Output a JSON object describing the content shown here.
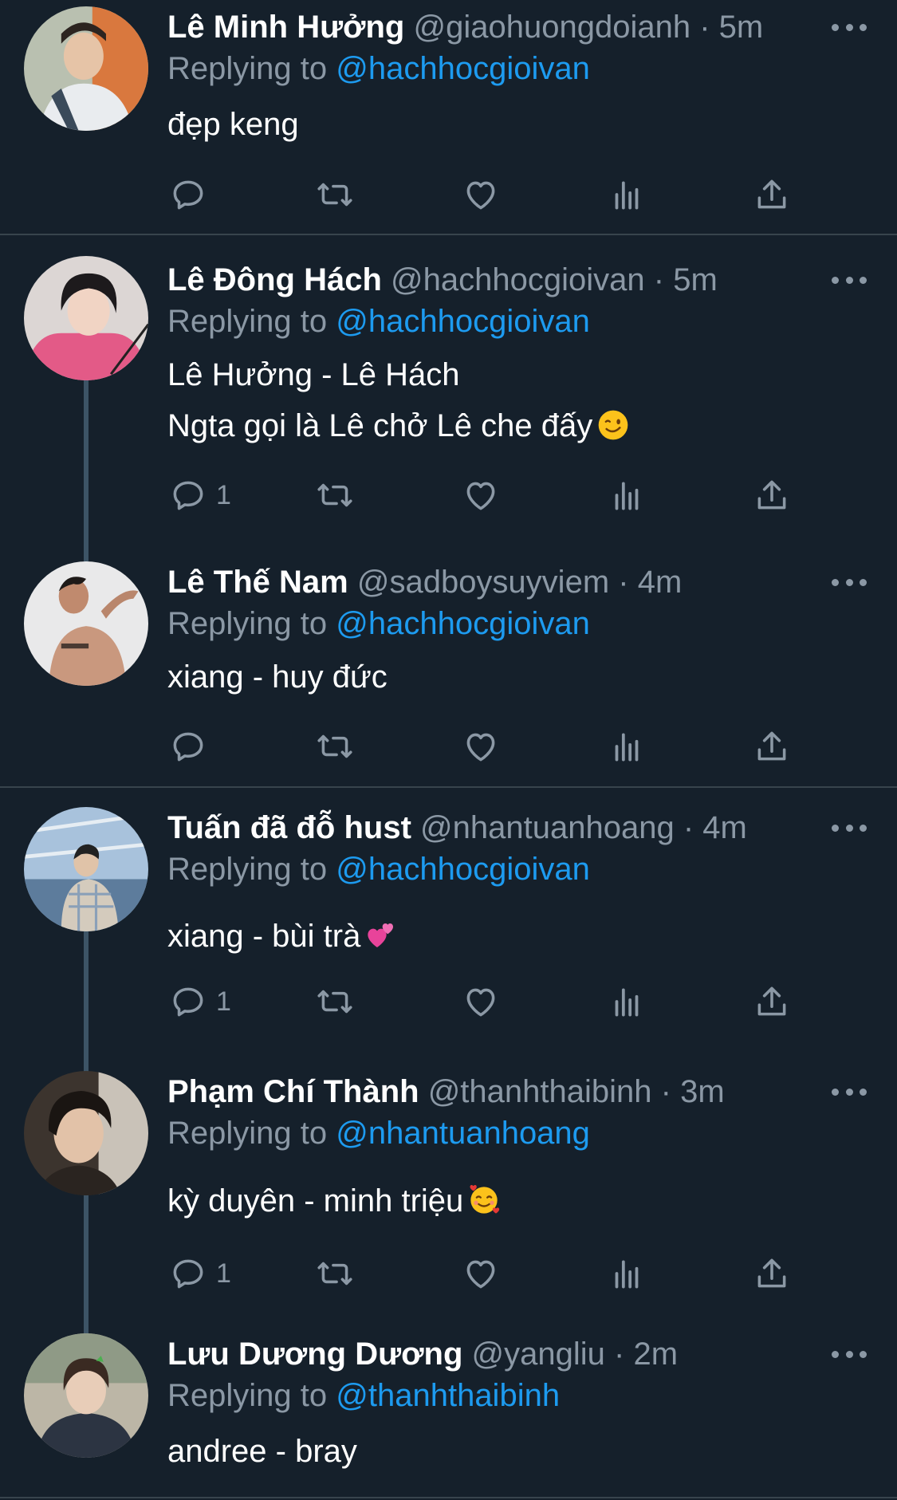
{
  "tweets": [
    {
      "name": "Lê Minh Hưởng",
      "handle": "@giaohuongdoianh",
      "separator": "·",
      "time": "5m",
      "replying_label": "Replying to",
      "replying_to": "@hachhocgioivan",
      "lines": [
        "đẹp keng"
      ],
      "emoji": null,
      "reply_count": "",
      "avatar_icon": "avatar-photo"
    },
    {
      "name": "Lê Đông Hách",
      "handle": "@hachhocgioivan",
      "separator": "·",
      "time": "5m",
      "replying_label": "Replying to",
      "replying_to": "@hachhocgioivan",
      "lines": [
        "Lê Hưởng - Lê Hách",
        "Ngta gọi là Lê chở Lê che đấy"
      ],
      "emoji": "winking-face-emoji",
      "reply_count": "1",
      "avatar_icon": "avatar-photo"
    },
    {
      "name": "Lê Thế Nam",
      "handle": "@sadboysuyviem",
      "separator": "·",
      "time": "4m",
      "replying_label": "Replying to",
      "replying_to": "@hachhocgioivan",
      "lines": [
        "xiang - huy đức"
      ],
      "emoji": null,
      "reply_count": "",
      "avatar_icon": "avatar-photo"
    },
    {
      "name": "Tuấn đã đỗ hust",
      "handle": "@nhantuanhoang",
      "separator": "·",
      "time": "4m",
      "replying_label": "Replying to",
      "replying_to": "@hachhocgioivan",
      "lines": [
        "xiang - bùi trà"
      ],
      "emoji": "two-hearts-emoji",
      "reply_count": "1",
      "avatar_icon": "avatar-photo"
    },
    {
      "name": "Phạm Chí Thành",
      "handle": "@thanhthaibinh",
      "separator": "·",
      "time": "3m",
      "replying_label": "Replying to",
      "replying_to": "@nhantuanhoang",
      "lines": [
        "kỳ duyên - minh triệu"
      ],
      "emoji": "smiling-face-with-hearts-emoji",
      "reply_count": "1",
      "avatar_icon": "avatar-photo"
    },
    {
      "name": "Lưu Dương Dương",
      "handle": "@yangliu",
      "separator": "·",
      "time": "2m",
      "replying_label": "Replying to",
      "replying_to": "@thanhthaibinh",
      "lines": [
        "andree - bray"
      ],
      "emoji": null,
      "reply_count": "",
      "avatar_icon": "avatar-photo"
    }
  ],
  "action_icons": [
    "reply-icon",
    "retweet-icon",
    "like-icon",
    "analytics-icon",
    "share-icon"
  ],
  "colors": {
    "background": "#15202b",
    "secondary_text": "#8b98a5",
    "link": "#1d9bf0",
    "divider": "#38444d"
  }
}
